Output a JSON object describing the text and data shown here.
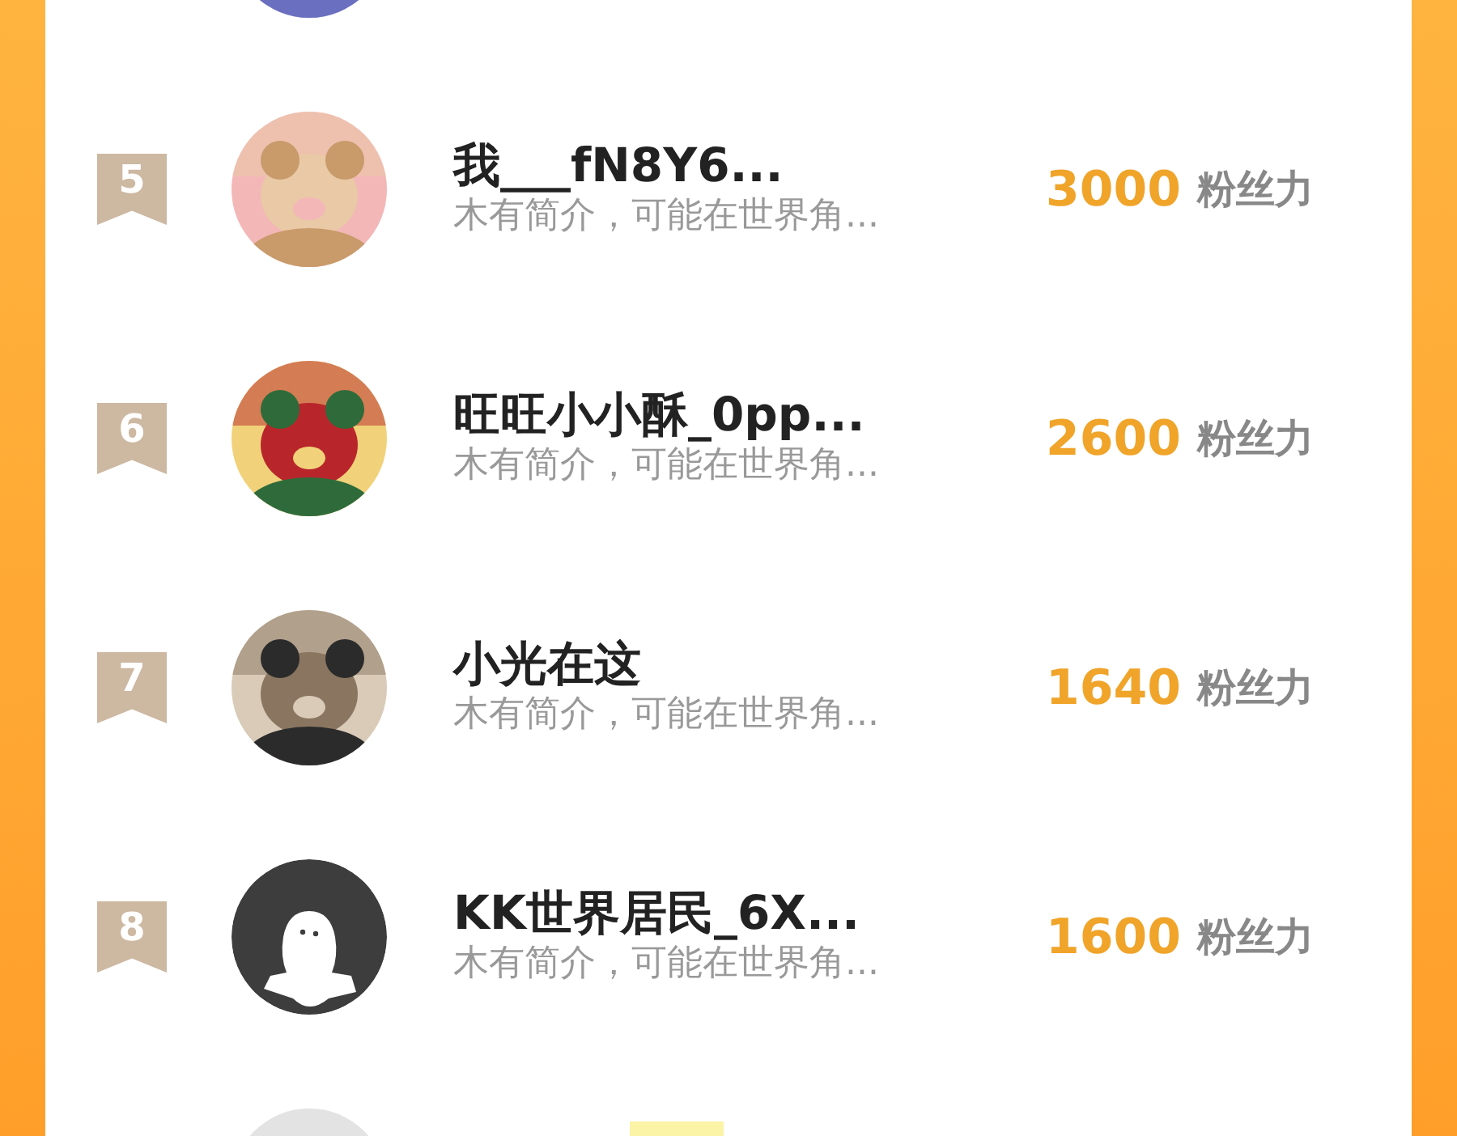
{
  "rows": [
    {
      "avatar": {
        "kind": "picture"
      }
    },
    {
      "rank": "5",
      "name": "我___fN8Y6...",
      "bio": "木有简介，可能在世界角...",
      "score": "3000",
      "unit": "粉丝力",
      "avatar": {
        "kind": "picture"
      }
    },
    {
      "rank": "6",
      "name": "旺旺小小酥_0pp...",
      "bio": "木有简介，可能在世界角...",
      "score": "2600",
      "unit": "粉丝力",
      "avatar": {
        "kind": "picture"
      }
    },
    {
      "rank": "7",
      "name": "小光在这",
      "bio": "木有简介，可能在世界角...",
      "score": "1640",
      "unit": "粉丝力",
      "avatar": {
        "kind": "picture"
      }
    },
    {
      "rank": "8",
      "name": "KK世界居民_6X...",
      "bio": "木有简介，可能在世界角...",
      "score": "1600",
      "unit": "粉丝力",
      "avatar": {
        "kind": "default"
      }
    },
    {
      "avatar": {
        "kind": "picture"
      },
      "tag": true
    }
  ]
}
